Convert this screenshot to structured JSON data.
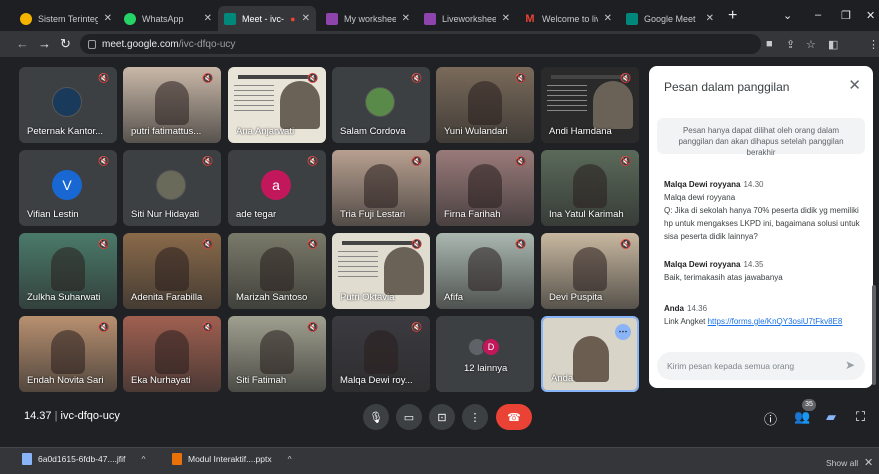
{
  "browser": {
    "tabs": [
      {
        "title": "Sistem Terintegra",
        "favicon": "ministry-logo-icon",
        "color": "#f4b400",
        "active": false
      },
      {
        "title": "WhatsApp",
        "favicon": "whatsapp-icon",
        "color": "#25d366",
        "active": false
      },
      {
        "title": "Meet - ivc-d",
        "favicon": "meet-icon",
        "color": "#00897b",
        "active": true
      },
      {
        "title": "My worksheets",
        "favicon": "liveworksheets-icon",
        "color": "#8e44ad",
        "active": false
      },
      {
        "title": "Liveworksheets.c",
        "favicon": "liveworksheets-icon",
        "color": "#8e44ad",
        "active": false
      },
      {
        "title": "Welcome to live",
        "favicon": "gmail-icon",
        "color": "#ea4335",
        "active": false
      },
      {
        "title": "Google Meet",
        "favicon": "meet-icon",
        "color": "#00897b",
        "active": false
      }
    ],
    "new_tab_symbol": "+",
    "url_host": "meet.google.com",
    "url_path": "/ivc-dfqo-ucy",
    "profile_initial": "V"
  },
  "meet": {
    "participants": [
      {
        "name": "Peternak Kantor...",
        "type": "avatar-photo",
        "color": "#1a3a5c"
      },
      {
        "name": "putri fatimattus...",
        "type": "photo",
        "color": "#c9b8a8"
      },
      {
        "name": "Ana Anjarwati",
        "type": "slide",
        "color": "#e9e4d8"
      },
      {
        "name": "Salam Cordova",
        "type": "avatar-photo",
        "color": "#5a8a4a"
      },
      {
        "name": "Yuni Wulandari",
        "type": "photo",
        "color": "#7a6a5a"
      },
      {
        "name": "Andi Hamdana",
        "type": "slide",
        "color": "#2a2a2a"
      },
      {
        "name": "Vifian Lestin",
        "type": "avatar",
        "initial": "V",
        "color": "#1967d2"
      },
      {
        "name": "Siti Nur Hidayati",
        "type": "avatar-photo",
        "color": "#6a6a5a"
      },
      {
        "name": "ade tegar",
        "type": "avatar",
        "initial": "a",
        "color": "#c2185b"
      },
      {
        "name": "Tria Fuji Lestari",
        "type": "photo",
        "color": "#b8a090"
      },
      {
        "name": "Firna Farihah",
        "type": "photo",
        "color": "#9a7a7a"
      },
      {
        "name": "Ina Yatul Karimah",
        "type": "photo",
        "color": "#5a6a5a"
      },
      {
        "name": "Zulkha Suharwati",
        "type": "photo",
        "color": "#4a7a6a"
      },
      {
        "name": "Adenita Farabilla",
        "type": "photo",
        "color": "#8a6a4a"
      },
      {
        "name": "Marizah Santoso",
        "type": "photo",
        "color": "#7a7a6a"
      },
      {
        "name": "Putri Oktavia",
        "type": "slide",
        "color": "#e0dcd0"
      },
      {
        "name": "Afifa",
        "type": "photo",
        "color": "#aab8b0"
      },
      {
        "name": "Devi Puspita",
        "type": "photo",
        "color": "#c8b8a0"
      },
      {
        "name": "Endah Novita Sari",
        "type": "photo",
        "color": "#b89070"
      },
      {
        "name": "Eka Nurhayati",
        "type": "photo",
        "color": "#a06050"
      },
      {
        "name": "Siti Fatimah",
        "type": "photo",
        "color": "#a0a090"
      },
      {
        "name": "Malqa Dewi roy...",
        "type": "photo",
        "color": "#3a3a40"
      },
      {
        "name": "12 lainnya",
        "type": "others",
        "color": "#3c4043"
      },
      {
        "name": "Anda",
        "type": "self",
        "color": "#d8d4c8"
      }
    ],
    "time": "14.37",
    "meeting_code": "ivc-dfqo-ucy",
    "participant_count": "35"
  },
  "chat": {
    "title": "Pesan dalam panggilan",
    "notice": "Pesan hanya dapat dilihat oleh orang dalam panggilan dan akan dihapus setelah panggilan berakhir",
    "messages": [
      {
        "sender": "Malqa Dewi royyana",
        "time": "14.30",
        "lines": [
          "Malqa dewi royyana",
          "Q: Jika di sekolah hanya 70% peserta didik yg memiliki hp untuk mengakses LKPD ini, bagaimana solusi untuk sisa peserta didik lainnya?"
        ]
      },
      {
        "sender": "Malqa Dewi royyana",
        "time": "14.35",
        "lines": [
          "Baik, terimakasih atas jawabanya"
        ]
      },
      {
        "sender": "Anda",
        "time": "14.36",
        "prefix": "Link Angket",
        "link": "https://forms.gle/KnQY3osiU7tFkv8E8"
      }
    ],
    "input_placeholder": "Kirim pesan kepada semua orang"
  },
  "downloads": {
    "items": [
      {
        "name": "6a0d1615-6fdb-47....jfif",
        "color": "#8ab4f8"
      },
      {
        "name": "Modul Interaktif....pptx",
        "color": "#e8710a"
      }
    ],
    "show_all": "Show all"
  }
}
